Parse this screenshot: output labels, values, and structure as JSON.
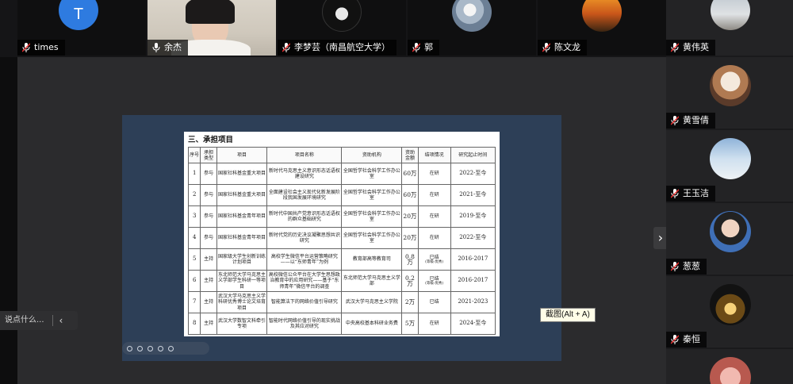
{
  "top_participants": [
    {
      "name": "times",
      "avatar_letter": "T",
      "avatar_color": "#2e7be0"
    },
    {
      "name": "余杰",
      "active": true
    },
    {
      "name": "李梦芸（南昌航空大学）"
    },
    {
      "name": "郭"
    },
    {
      "name": "陈文龙"
    }
  ],
  "right_participants": [
    {
      "name": "黄伟英"
    },
    {
      "name": "黄雪倩"
    },
    {
      "name": "王玉洁"
    },
    {
      "name": "葱葱"
    },
    {
      "name": "秦恒"
    }
  ],
  "icons": {
    "mic": "mic-icon",
    "next": "chevron-right-icon",
    "collapse": "chevron-left-icon"
  },
  "shared_doc": {
    "section_title": "三、承担项目",
    "headers": {
      "no": "序号",
      "role": "承担类型",
      "project": "项目",
      "name": "项目名称",
      "funder": "资助机构",
      "amount": "资助金额",
      "status": "结项情况",
      "period": "研究起止时间"
    },
    "rows": [
      {
        "no": "1",
        "role": "参与",
        "project": "国家社科基金重大项目",
        "name": "新时代马克思主义意识形态话语权建设研究",
        "funder": "全国哲学社会科学工作办公室",
        "amount": "60万",
        "status": "在研",
        "status_note": "",
        "period": "2022-至今"
      },
      {
        "no": "2",
        "role": "参与",
        "project": "国家社科基金重大项目",
        "name": "全面建设社会主义现代化新发展阶段我国发展环境研究",
        "funder": "全国哲学社会科学工作办公室",
        "amount": "60万",
        "status": "在研",
        "status_note": "",
        "period": "2021-至今"
      },
      {
        "no": "3",
        "role": "参与",
        "project": "国家社科基金青年项目",
        "name": "新时代中国共产党意识形态话语权的群众基础研究",
        "funder": "全国哲学社会科学工作办公室",
        "amount": "20万",
        "status": "在研",
        "status_note": "",
        "period": "2019-至今"
      },
      {
        "no": "4",
        "role": "参与",
        "project": "国家社科基金青年项目",
        "name": "新时代党的历史决议凝聚思想共识研究",
        "funder": "全国哲学社会科学工作办公室",
        "amount": "20万",
        "status": "在研",
        "status_note": "",
        "period": "2022-至今"
      },
      {
        "no": "5",
        "role": "主持",
        "project": "国家级大学生创新训练计划项目",
        "name": "高校学生微信平台运营策略研究——以“东师青年”为例",
        "funder": "教育部高等教育司",
        "amount": "0.8万",
        "status": "已结",
        "status_note": "(等级:优秀)",
        "period": "2016-2017"
      },
      {
        "no": "6",
        "role": "主持",
        "project": "东北师范大学马克思主义学部学生科研一等项目",
        "name": "高校微信公众平台在大学生思想政治教育中的应用研究——基于“东师青年”微信平台的调查",
        "funder": "东北师范大学马克思主义学部",
        "amount": "0.2万",
        "status": "已结",
        "status_note": "(等级:优秀)",
        "period": "2016-2017"
      },
      {
        "no": "7",
        "role": "主持",
        "project": "武汉大学马克思主义学科研优秀博士论文培育项目",
        "name": "智能算法下的网络价值引导研究",
        "funder": "武汉大学马克思主义学院",
        "amount": "2万",
        "status": "已结",
        "status_note": "",
        "period": "2021-2023"
      },
      {
        "no": "8",
        "role": "主持",
        "project": "武汉大学数智文科牵引专项",
        "name": "智能时代网络价值引导的现实挑战及其应对研究",
        "funder": "中央高校基本科研业务费",
        "amount": "5万",
        "status": "在研",
        "status_note": "",
        "period": "2024-至今"
      }
    ]
  },
  "tooltip": "截图(Alt + A)",
  "chat_placeholder": "说点什么...",
  "next_arrow": "›",
  "collapse_arrow": "‹"
}
